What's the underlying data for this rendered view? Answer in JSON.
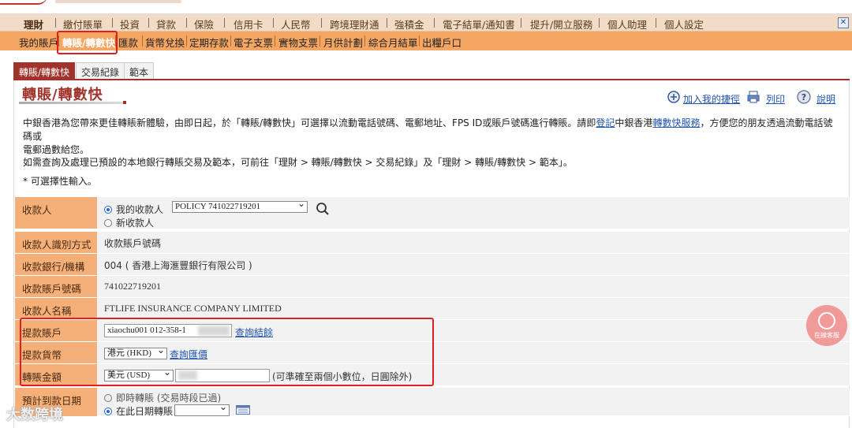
{
  "main_nav": [
    "理財",
    "繳付賬單",
    "投資",
    "貸款",
    "保險",
    "信用卡",
    "人民幣",
    "跨境理財通",
    "強積金",
    "電子結單/通知書",
    "提升/開立服務",
    "個人助理",
    "個人設定"
  ],
  "sub_nav": [
    "我的賬戶",
    "轉賬/轉數快",
    "匯款",
    "貨幣兌換",
    "定期存款",
    "電子支票",
    "實物支票",
    "月供計劃",
    "綜合月結單",
    "出糧戶口"
  ],
  "tabs": [
    "轉賬/轉數快",
    "交易紀錄",
    "範本"
  ],
  "page_title": "轉賬/轉數快",
  "top_links": {
    "favorite": "加入我的捷徑",
    "print": "列印",
    "help": "說明"
  },
  "intro": {
    "p1_a": "中銀香港為您帶來更佳轉賬新體驗，由即日起，於「轉賬/轉數快」可選擇以流動電話號碼、電郵地址、FPS ID或賬戶號碼進行轉賬。請即",
    "p1_link1": "登記",
    "p1_b": "中銀香港",
    "p1_link2": "轉數快服務",
    "p1_c": "，方便您的朋友透過流動電話號碼或",
    "p1_d": "電郵過數給您。",
    "p2": "如需查詢及處理已預設的本地銀行轉賬交易及範本，可前往「理財 > 轉賬/轉數快 > 交易紀錄」及「理財 > 轉賬/轉數快 > 範本」。",
    "p3": "* 可選擇性輸入。"
  },
  "form": {
    "payee_label": "收款人",
    "payee_opt_mine": "我的收款人",
    "payee_selected": "POLICY 741022719201",
    "payee_opt_new": "新收款人",
    "id_method_label": "收款人識別方式",
    "id_method_value": "收款賬戶號碼",
    "bank_label": "收款銀行/機構",
    "bank_value": "004 ( 香港上海滙豐銀行有限公司 )",
    "acct_label": "收款賬戶號碼",
    "acct_value": "741022719201",
    "name_label": "收款人名稱",
    "name_value": "FTLIFE INSURANCE COMPANY LIMITED",
    "debit_label": "提款賬戶",
    "debit_value": "xiaochu001 012-358-1",
    "debit_link": "查詢結餘",
    "currency_label": "提款貨幣",
    "currency_value": "港元 (HKD)",
    "currency_link": "查詢匯價",
    "amount_label": "轉賬金額",
    "amount_currency": "美元 (USD)",
    "amount_value": "",
    "amount_hint": "(可準確至兩個小數位，日圓除外)",
    "date_label": "預計到款日期",
    "date_opt_now": "即時轉賬 (交易時段已過)",
    "date_opt_later": "在此日期轉賬",
    "date_value": ""
  },
  "watermark": "大数跨境",
  "cs_button": "在線客服"
}
